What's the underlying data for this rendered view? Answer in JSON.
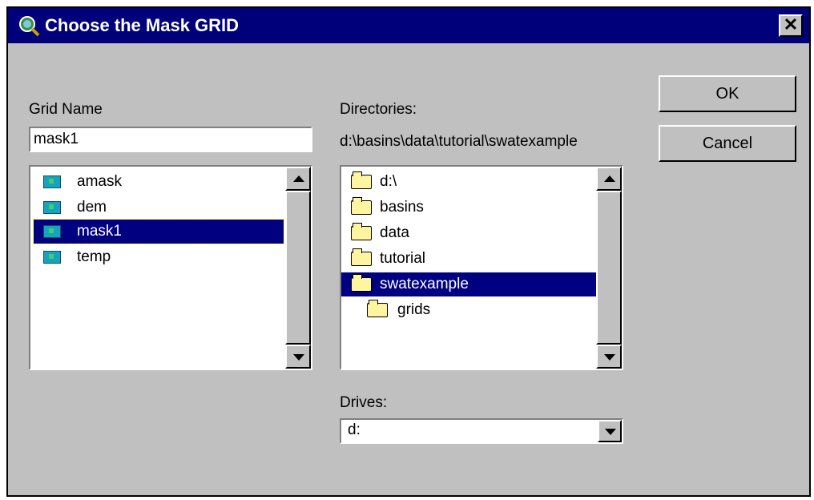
{
  "window": {
    "title": "Choose the Mask GRID",
    "close_glyph": "✕",
    "title_bar_color": "#00007b"
  },
  "grid_name": {
    "label": "Grid Name",
    "value": "mask1",
    "items": [
      {
        "name": "amask",
        "icon": "grid-icon"
      },
      {
        "name": "dem",
        "icon": "grid-icon"
      },
      {
        "name": "mask1",
        "icon": "grid-icon",
        "selected": true
      },
      {
        "name": "temp",
        "icon": "grid-icon"
      }
    ]
  },
  "directories": {
    "label": "Directories:",
    "path": "d:\\basins\\data\\tutorial\\swatexample",
    "items": [
      {
        "name": "d:\\",
        "icon": "open-folder-icon"
      },
      {
        "name": "basins",
        "icon": "open-folder-icon"
      },
      {
        "name": "data",
        "icon": "open-folder-icon"
      },
      {
        "name": "tutorial",
        "icon": "open-folder-icon"
      },
      {
        "name": "swatexample",
        "icon": "open-folder-icon",
        "selected": true
      },
      {
        "name": "grids",
        "icon": "closed-folder-icon"
      }
    ]
  },
  "drives": {
    "label": "Drives:",
    "value": "d:"
  },
  "buttons": {
    "ok": "OK",
    "cancel": "Cancel"
  }
}
